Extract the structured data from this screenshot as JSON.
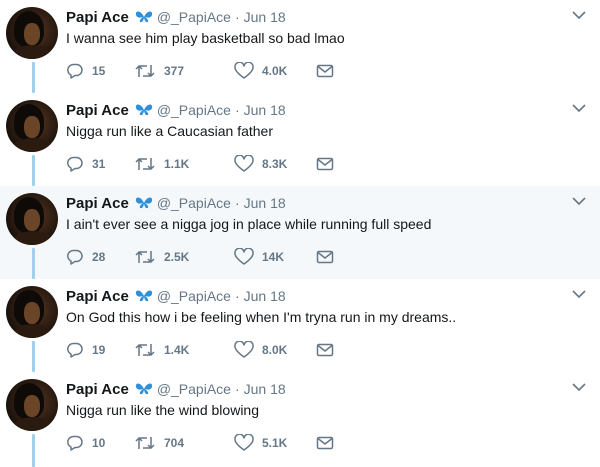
{
  "tweets": [
    {
      "name": "Papi Ace",
      "badge_icon": "butterfly-emoji",
      "handle": "@_PapiAce",
      "separator": "·",
      "date": "Jun 18",
      "text": "I wanna see him play basketball so bad lmao",
      "replies": "15",
      "retweets": "377",
      "likes": "4.0K"
    },
    {
      "name": "Papi Ace",
      "badge_icon": "butterfly-emoji",
      "handle": "@_PapiAce",
      "separator": "·",
      "date": "Jun 18",
      "text": "Nigga run like a Caucasian father",
      "replies": "31",
      "retweets": "1.1K",
      "likes": "8.3K"
    },
    {
      "name": "Papi Ace",
      "badge_icon": "butterfly-emoji",
      "handle": "@_PapiAce",
      "separator": "·",
      "date": "Jun 18",
      "text": "I ain't ever see a nigga jog in place while running full speed",
      "replies": "28",
      "retweets": "2.5K",
      "likes": "14K"
    },
    {
      "name": "Papi Ace",
      "badge_icon": "butterfly-emoji",
      "handle": "@_PapiAce",
      "separator": "·",
      "date": "Jun 18",
      "text": "On God this how i be feeling when I'm tryna run in my dreams..",
      "replies": "19",
      "retweets": "1.4K",
      "likes": "8.0K"
    },
    {
      "name": "Papi Ace",
      "badge_icon": "butterfly-emoji",
      "handle": "@_PapiAce",
      "separator": "·",
      "date": "Jun 18",
      "text": "Nigga run like the wind blowing",
      "replies": "10",
      "retweets": "704",
      "likes": "5.1K"
    }
  ],
  "colors": {
    "thread_line": "#9fd1ef",
    "secondary_text": "#657786",
    "primary_text": "#14171a",
    "highlight_bg": "#f5f8fa",
    "badge_blue": "#2f8fd8"
  }
}
